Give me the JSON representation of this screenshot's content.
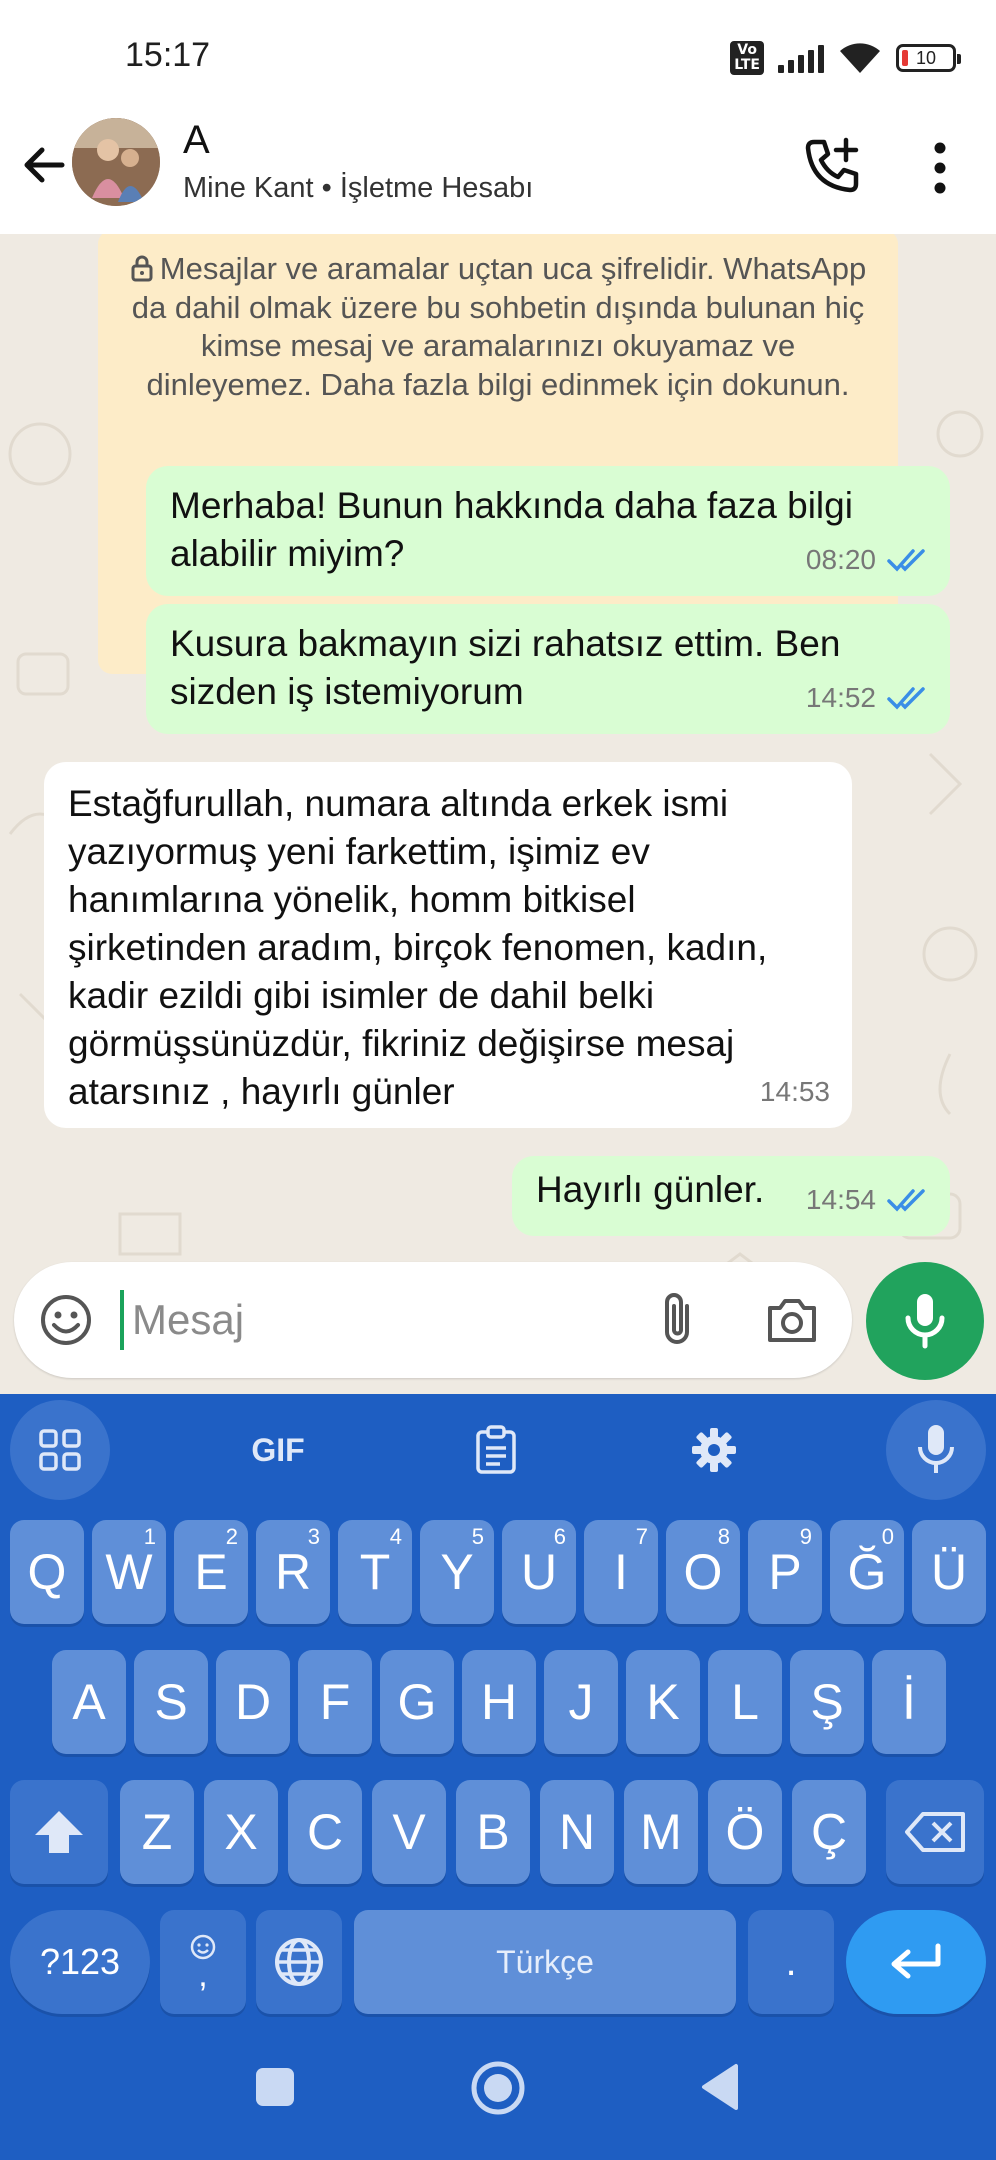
{
  "status_bar": {
    "time": "15:17",
    "volte_label": "Vo LTE",
    "battery": "10"
  },
  "header": {
    "contact_name": "A",
    "subtitle": "Mine Kant • İşletme Hesabı"
  },
  "encryption_notice": "Mesajlar ve aramalar uçtan uca şifrelidir. WhatsApp da dahil olmak üzere bu sohbetin dışında bulunan hiç kimse mesaj ve aramalarınızı okuyamaz ve dinleyemez. Daha fazla bilgi edinmek için dokunun.",
  "messages": [
    {
      "direction": "out",
      "text": "Merhaba! Bunun hakkında daha faza bilgi alabilir miyim?",
      "time": "08:20",
      "status": "read"
    },
    {
      "direction": "out",
      "text": "Kusura bakmayın sizi rahatsız ettim. Ben sizden iş istemiyorum",
      "time": "14:52",
      "status": "read"
    },
    {
      "direction": "in",
      "text": "Estağfurullah,  numara altında erkek ismi yazıyormuş yeni farkettim, işimiz ev hanımlarına yönelik, homm bitkisel şirketinden aradım, birçok fenomen, kadın, kadir ezildi gibi isimler de dahil belki görmüşsünüzdür,  fikriniz değişirse mesaj atarsınız , hayırlı günler",
      "time": "14:53"
    },
    {
      "direction": "out",
      "text": "Hayırlı günler.",
      "time": "14:54",
      "status": "read"
    }
  ],
  "composer": {
    "placeholder": "Mesaj"
  },
  "keyboard": {
    "toolbar_gif": "GIF",
    "row1": [
      {
        "k": "Q",
        "h": ""
      },
      {
        "k": "W",
        "h": "1"
      },
      {
        "k": "E",
        "h": "2"
      },
      {
        "k": "R",
        "h": "3"
      },
      {
        "k": "T",
        "h": "4"
      },
      {
        "k": "Y",
        "h": "5"
      },
      {
        "k": "U",
        "h": "6"
      },
      {
        "k": "I",
        "h": "7"
      },
      {
        "k": "O",
        "h": "8"
      },
      {
        "k": "P",
        "h": "9"
      },
      {
        "k": "Ğ",
        "h": "0"
      },
      {
        "k": "Ü",
        "h": ""
      }
    ],
    "row2": [
      "A",
      "S",
      "D",
      "F",
      "G",
      "H",
      "J",
      "K",
      "L",
      "Ş",
      "İ"
    ],
    "row3": [
      "Z",
      "X",
      "C",
      "V",
      "B",
      "N",
      "M",
      "Ö",
      "Ç"
    ],
    "symbols_label": "?123",
    "comma": ",",
    "space_label": "Türkçe",
    "period": "."
  },
  "colors": {
    "chat_bg": "#efeae2",
    "outgoing_bubble": "#d9fdd3",
    "incoming_bubble": "#ffffff",
    "notice_bg": "#fdecc8",
    "accent_green": "#21a35d",
    "keyboard_bg": "#1e5ec2",
    "key_bg": "#5f8fd8",
    "read_tick": "#3a8ee6"
  },
  "icons": {
    "back": "arrow-left-icon",
    "add_call": "phone-plus-icon",
    "menu": "more-vert-icon",
    "emoji": "emoji-icon",
    "attach": "paperclip-icon",
    "camera": "camera-icon",
    "mic": "mic-icon"
  }
}
